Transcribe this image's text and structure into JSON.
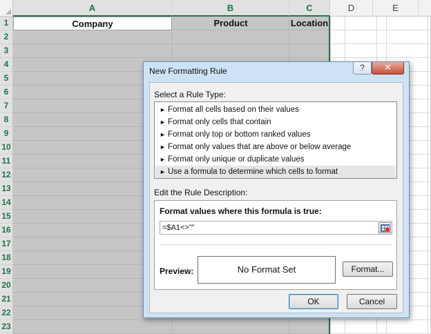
{
  "sheet": {
    "columns": [
      "A",
      "B",
      "C",
      "D",
      "E"
    ],
    "rows": [
      "1",
      "2",
      "3",
      "4",
      "5",
      "6",
      "7",
      "8",
      "9",
      "10",
      "11",
      "12",
      "13",
      "14",
      "15",
      "16",
      "17",
      "18",
      "19",
      "20",
      "21",
      "22",
      "23"
    ],
    "headers": {
      "a1": "Company",
      "b1": "Product",
      "c1": "Location"
    },
    "accent_color": "#217346",
    "selection_color": "#c6c6c6"
  },
  "dialog": {
    "title": "New Formatting Rule",
    "help_label": "?",
    "close_label": "✕",
    "select_rule_type_label": "Select a Rule Type:",
    "rule_types": [
      "Format all cells based on their values",
      "Format only cells that contain",
      "Format only top or bottom ranked values",
      "Format only values that are above or below average",
      "Format only unique or duplicate values",
      "Use a formula to determine which cells to format"
    ],
    "selected_rule_index": 5,
    "edit_description_label": "Edit the Rule Description:",
    "formula_label": "Format values where this formula is true:",
    "formula_value": "=$A1<>\"\"",
    "preview_label": "Preview:",
    "preview_text": "No Format Set",
    "format_button": "Format...",
    "ok_button": "OK",
    "cancel_button": "Cancel",
    "bullet_icon": "arrow-bullet-icon",
    "range_icon": "collapse-dialog-icon"
  }
}
